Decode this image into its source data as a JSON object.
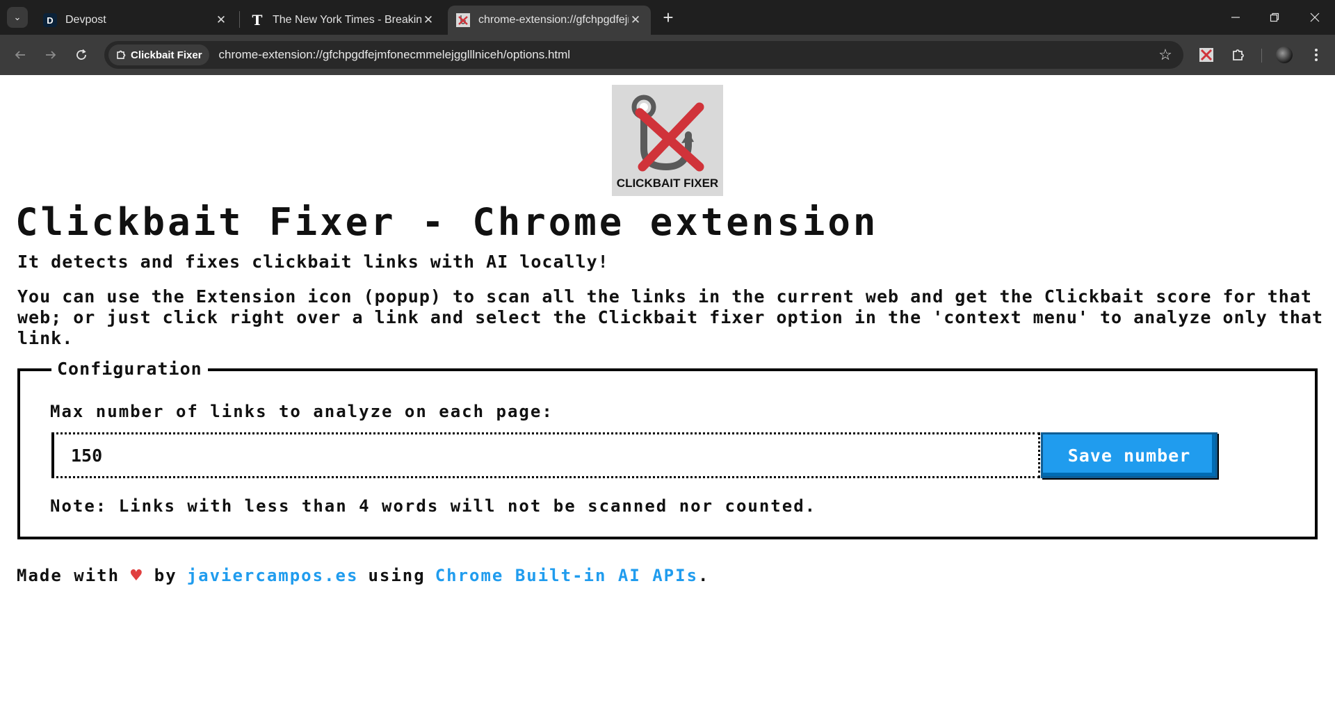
{
  "browser": {
    "tabs": [
      {
        "title": "Devpost",
        "favicon": "D"
      },
      {
        "title": "The New York Times - Breaking",
        "favicon": "T"
      },
      {
        "title": "chrome-extension://gfchpgdfejm",
        "favicon": "clickbait-fixer-icon"
      }
    ],
    "new_tab_label": "+",
    "address_bar": {
      "chip_label": "Clickbait Fixer",
      "url": "chrome-extension://gfchpgdfejmfonecmmelejgglllniceh/options.html"
    }
  },
  "page": {
    "logo_caption": "CLICKBAIT FIXER",
    "title": "Clickbait Fixer - Chrome extension",
    "subtitle": "It detects and fixes clickbait links with AI locally!",
    "description": "You can use the Extension icon (popup) to scan all the links in the current web and get the Clickbait score for that web; or just click right over a link and select the Clickbait fixer option in the 'context menu' to analyze only that link.",
    "config": {
      "legend": "Configuration",
      "label": "Max number of links to analyze on each page:",
      "value": "150",
      "save_label": "Save number",
      "note": "Note: Links with less than 4 words will not be scanned nor counted."
    },
    "footer": {
      "made_with": "Made with",
      "heart": "♥",
      "by": "by",
      "author_link": "javiercampos.es",
      "using": "using",
      "api_link": "Chrome Built-in AI APIs",
      "end": "."
    }
  },
  "colors": {
    "accent": "#209cee",
    "chrome_dark": "#1f1f1f",
    "chrome_toolbar": "#3c3c3c",
    "logo_red": "#d0333a"
  }
}
